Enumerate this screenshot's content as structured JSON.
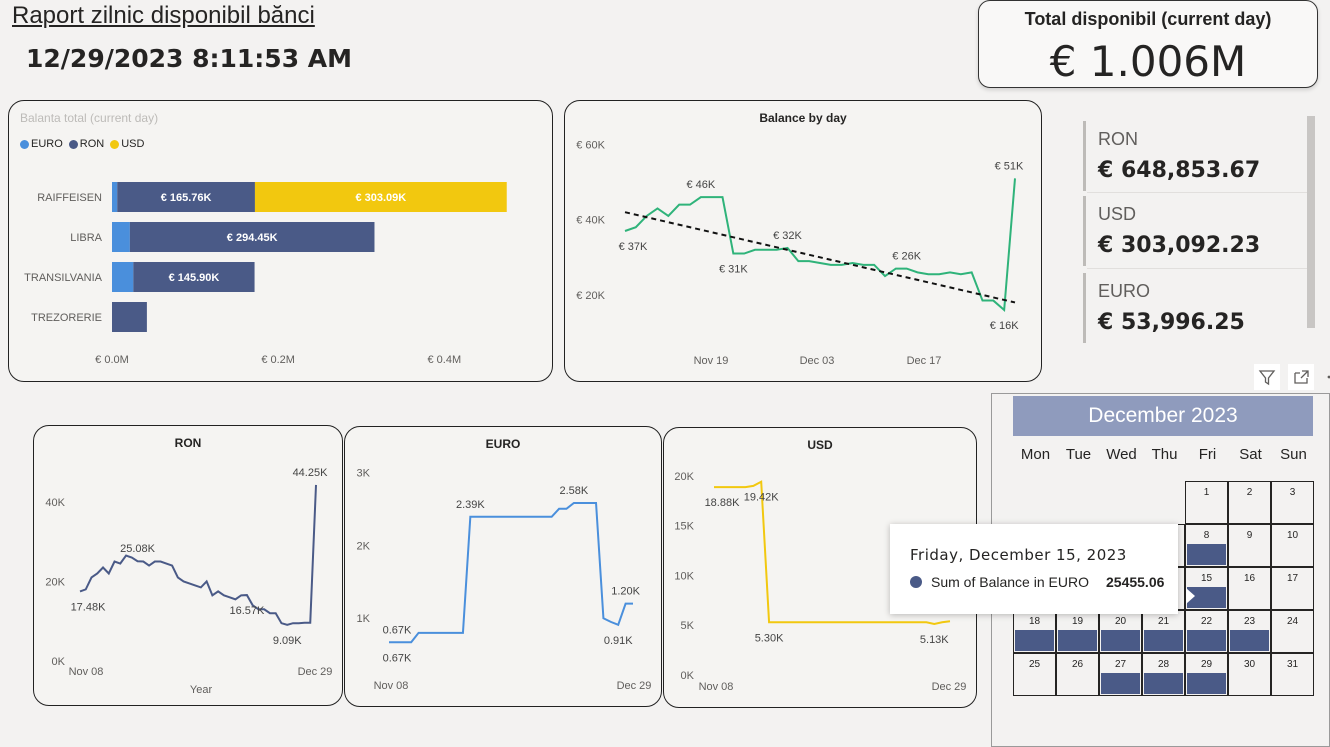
{
  "header": {
    "title": "Raport zilnic disponibil bănci",
    "datetime": "12/29/2023 8:11:53 AM"
  },
  "kpi": {
    "title": "Total disponibil (current day)",
    "value": "€ 1.006M"
  },
  "cards": [
    {
      "label": "RON",
      "value": "€ 648,853.67"
    },
    {
      "label": "USD",
      "value": "€ 303,092.23"
    },
    {
      "label": "EURO",
      "value": "€ 53,996.25"
    }
  ],
  "colors": {
    "euro": "#4a8fdc",
    "ron": "#4a5a87",
    "usd": "#f2c80f",
    "green": "#2fb37a"
  },
  "bank_chart": {
    "title": "Balanta total (current day)",
    "legend": [
      {
        "name": "EURO",
        "color": "#4a8fdc"
      },
      {
        "name": "RON",
        "color": "#4a5a87"
      },
      {
        "name": "USD",
        "color": "#f2c80f"
      }
    ],
    "ticks": [
      "€ 0.0M",
      "€ 0.2M",
      "€ 0.4M"
    ]
  },
  "chart_data": [
    {
      "type": "bar",
      "title": "Balanta total (current day)",
      "orientation": "horizontal",
      "stacked": true,
      "categories": [
        "RAIFFEISEN",
        "LIBRA",
        "TRANSILVANIA",
        "TREZORERIE"
      ],
      "series": [
        {
          "name": "EURO",
          "values": [
            6300,
            21500,
            25700,
            0
          ],
          "labels": [
            "",
            "",
            "",
            ""
          ]
        },
        {
          "name": "RON",
          "values": [
            165760,
            294450,
            145900,
            42000
          ],
          "labels": [
            "€ 165.76K",
            "€ 294.45K",
            "€ 145.90K",
            ""
          ]
        },
        {
          "name": "USD",
          "values": [
            303090,
            0,
            0,
            0
          ],
          "labels": [
            "€ 303.09K",
            "",
            "",
            ""
          ]
        }
      ],
      "xlim": [
        0,
        0.52
      ],
      "xticks": [
        {
          "v": 0,
          "t": "€ 0.0M"
        },
        {
          "v": 0.2,
          "t": "€ 0.2M"
        },
        {
          "v": 0.4,
          "t": "€ 0.4M"
        }
      ],
      "legend": "top-left"
    },
    {
      "type": "line",
      "title": "Balance by day",
      "x": [
        "Nov 08",
        "Nov 09",
        "Nov 10",
        "Nov 13",
        "Nov 14",
        "Nov 15",
        "Nov 16",
        "Nov 17",
        "Nov 20",
        "Nov 21",
        "Nov 22",
        "Nov 23",
        "Nov 24",
        "Nov 27",
        "Nov 28",
        "Nov 29",
        "Nov 30",
        "Dec 01",
        "Dec 04",
        "Dec 05",
        "Dec 06",
        "Dec 07",
        "Dec 08",
        "Dec 11",
        "Dec 12",
        "Dec 13",
        "Dec 14",
        "Dec 15",
        "Dec 18",
        "Dec 19",
        "Dec 20",
        "Dec 21",
        "Dec 22",
        "Dec 27",
        "Dec 28",
        "Dec 29"
      ],
      "values": [
        37,
        38,
        41,
        43,
        41,
        44,
        44,
        46,
        46,
        46,
        31,
        31,
        32,
        32,
        32,
        32.5,
        29,
        29,
        28.5,
        28,
        28,
        28.5,
        28,
        28,
        25,
        27,
        27,
        26,
        25.5,
        25.5,
        26,
        25.5,
        26,
        18.5,
        18.5,
        16
      ],
      "series_color": "#2fb37a",
      "yticks": [
        {
          "v": 20,
          "t": "€ 20K"
        },
        {
          "v": 40,
          "t": "€ 40K"
        },
        {
          "v": 60,
          "t": "€ 60K"
        }
      ],
      "ylim": [
        12,
        62
      ],
      "xticks": [
        "Nov 19",
        "Dec 03",
        "Dec 17"
      ],
      "data_labels": [
        {
          "i": 0,
          "t": "€ 37K",
          "pos": "below"
        },
        {
          "i": 7,
          "t": "€ 46K",
          "pos": "above"
        },
        {
          "i": 10,
          "t": "€ 31K",
          "pos": "below"
        },
        {
          "i": 15,
          "t": "€ 32K",
          "pos": "above"
        },
        {
          "i": 26,
          "t": "€ 26K",
          "pos": "above"
        },
        {
          "i": 35,
          "t": "€ 16K",
          "pos": "below"
        },
        {
          "i": 36,
          "t": "€ 51K",
          "pos": "above"
        }
      ],
      "trendline": [
        42,
        18
      ]
    },
    {
      "type": "line",
      "title": "RON",
      "xticks": [
        "Nov 08",
        "Dec 29"
      ],
      "xlabel": "Year",
      "values": [
        17.48,
        18,
        21,
        22,
        23.5,
        22,
        25,
        24.5,
        26.5,
        26,
        25.08,
        25,
        24,
        25,
        25,
        24.5,
        24,
        21,
        20,
        19.5,
        19,
        18.5,
        20,
        16.5,
        17.5,
        16.5,
        16,
        15.5,
        16.5,
        16.57,
        14,
        13,
        13,
        12,
        12,
        9.5,
        9.09,
        9.5,
        9.5,
        9.6,
        9.6,
        44.25
      ],
      "series_color": "#4a5a87",
      "yticks": [
        {
          "v": 0,
          "t": "0K"
        },
        {
          "v": 20,
          "t": "20K"
        },
        {
          "v": 40,
          "t": "40K"
        }
      ],
      "ylim": [
        0,
        47
      ],
      "data_labels": [
        {
          "i": 0,
          "t": "17.48K",
          "pos": "below"
        },
        {
          "i": 10,
          "t": "25.08K",
          "pos": "above"
        },
        {
          "i": 29,
          "t": "16.57K",
          "pos": "below"
        },
        {
          "i": 36,
          "t": "9.09K",
          "pos": "below"
        },
        {
          "i": 41,
          "t": "44.25K",
          "pos": "above"
        }
      ]
    },
    {
      "type": "line",
      "title": "EURO",
      "xticks": [
        "Nov 08",
        "Dec 29"
      ],
      "values": [
        0.67,
        0.67,
        0.67,
        0.67,
        0.8,
        0.8,
        0.8,
        0.8,
        0.8,
        0.8,
        0.8,
        2.39,
        2.39,
        2.39,
        2.39,
        2.39,
        2.39,
        2.39,
        2.39,
        2.39,
        2.39,
        2.39,
        2.39,
        2.5,
        2.5,
        2.58,
        2.58,
        2.58,
        2.58,
        1.0,
        0.95,
        0.91,
        1.2,
        1.2
      ],
      "series_color": "#4a8fdc",
      "yticks": [
        {
          "v": 1,
          "t": "1K"
        },
        {
          "v": 2,
          "t": "2K"
        },
        {
          "v": 3,
          "t": "3K"
        }
      ],
      "ylim": [
        0.4,
        3.1
      ],
      "data_labels": [
        {
          "i": 0,
          "t": "0.67K",
          "pos": "above"
        },
        {
          "i": 0,
          "t": "0.67K",
          "pos": "below"
        },
        {
          "i": 11,
          "t": "2.39K",
          "pos": "above"
        },
        {
          "i": 25,
          "t": "2.58K",
          "pos": "above"
        },
        {
          "i": 31,
          "t": "0.91K",
          "pos": "below"
        },
        {
          "i": 32,
          "t": "1.20K",
          "pos": "above"
        }
      ]
    },
    {
      "type": "line",
      "title": "USD",
      "xticks": [
        "Nov 08",
        "Dec 29"
      ],
      "values": [
        18.88,
        18.88,
        18.88,
        18.88,
        18.88,
        19,
        19.42,
        5.3,
        5.3,
        5.3,
        5.3,
        5.3,
        5.3,
        5.3,
        5.3,
        5.3,
        5.3,
        5.3,
        5.3,
        5.3,
        5.3,
        5.3,
        5.3,
        5.3,
        5.3,
        5.3,
        5.3,
        5.3,
        5.13,
        5.3,
        5.4
      ],
      "series_color": "#f2c80f",
      "yticks": [
        {
          "v": 0,
          "t": "0K"
        },
        {
          "v": 5,
          "t": "5K"
        },
        {
          "v": 10,
          "t": "10K"
        },
        {
          "v": 15,
          "t": "15K"
        },
        {
          "v": 20,
          "t": "20K"
        }
      ],
      "ylim": [
        0,
        21
      ],
      "data_labels": [
        {
          "i": 0,
          "t": "18.88K",
          "pos": "below"
        },
        {
          "i": 6,
          "t": "19.42K",
          "pos": "below"
        },
        {
          "i": 7,
          "t": "5.30K",
          "pos": "below"
        },
        {
          "i": 28,
          "t": "5.13K",
          "pos": "below"
        }
      ]
    }
  ],
  "calendar": {
    "month": "December 2023",
    "weekdays": [
      "Mon",
      "Tue",
      "Wed",
      "Thu",
      "Fri",
      "Sat",
      "Sun"
    ],
    "weeks": [
      [
        "",
        "",
        "",
        "",
        "1",
        "2",
        "3"
      ],
      [
        "4",
        "5",
        "6",
        "7",
        "8",
        "9",
        "10"
      ],
      [
        "11",
        "12",
        "13",
        "14",
        "15",
        "16",
        "17"
      ],
      [
        "18",
        "19",
        "20",
        "21",
        "22",
        "23",
        "24"
      ],
      [
        "25",
        "26",
        "27",
        "28",
        "29",
        "30",
        "31"
      ]
    ],
    "filled": {
      "8": 1,
      "15": 1,
      "18": 1,
      "19": 1,
      "20": 1,
      "21": 1,
      "22": 1,
      "23": 1,
      "27": 1,
      "28": 1,
      "29": 1
    }
  },
  "tooltip": {
    "date": "Friday, December 15, 2023",
    "series": "Sum of Balance in EURO",
    "value": "25455.06"
  }
}
